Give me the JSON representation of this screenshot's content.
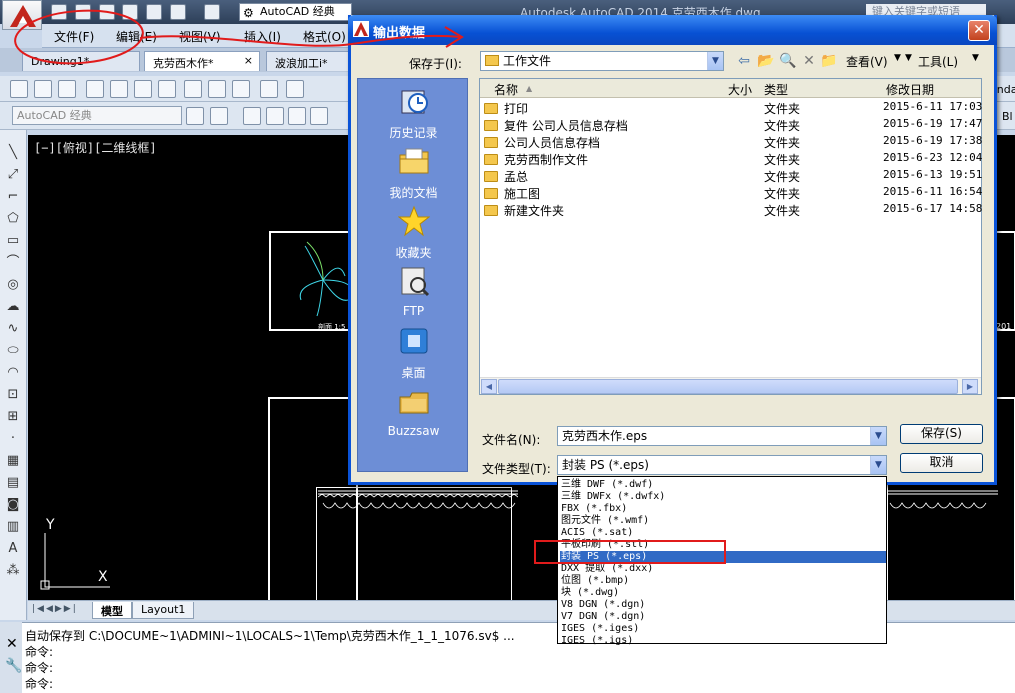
{
  "app": {
    "title": "Autodesk AutoCAD 2014    克劳西木作.dwg",
    "search_placeholder": "键入关键字或短语",
    "workspace": "AutoCAD 经典",
    "menu": [
      "文件(F)",
      "编辑(E)",
      "视图(V)",
      "插入(I)",
      "格式(O)"
    ],
    "doc_tabs": [
      "Drawing1*",
      "克劳西木作*",
      "波浪加工i*"
    ],
    "style_select": "AutoCAD 经典",
    "right_labels": [
      "andar",
      "Bl"
    ]
  },
  "canvas": {
    "view_label": "[−][俯视][二维线框]",
    "ucs_y": "Y",
    "ucs_x": "X",
    "frame_caption_left": "剖面 1:5",
    "frame_caption_right": "201"
  },
  "layout_tabs": [
    "模型",
    "Layout1"
  ],
  "command": {
    "autosave": "自动保存到 C:\\DOCUME~1\\ADMINI~1\\LOCALS~1\\Temp\\克劳西木作_1_1_1076.sv$ ...",
    "prompts": [
      "命令:",
      "命令:",
      "命令:"
    ]
  },
  "dialog": {
    "title": "输出数据",
    "save_in_label": "保存于(I):",
    "save_in_value": "工作文件",
    "view_label": "查看(V)",
    "tools_label": "工具(L)",
    "places": [
      {
        "label": "历史记录",
        "icon": "history-icon"
      },
      {
        "label": "我的文档",
        "icon": "my-documents-icon"
      },
      {
        "label": "收藏夹",
        "icon": "favorites-star-icon"
      },
      {
        "label": "FTP",
        "icon": "ftp-icon"
      },
      {
        "label": "桌面",
        "icon": "desktop-icon"
      },
      {
        "label": "Buzzsaw",
        "icon": "buzzsaw-icon"
      }
    ],
    "columns": [
      "名称",
      "大小",
      "类型",
      "修改日期"
    ],
    "files": [
      {
        "name": "打印",
        "type": "文件夹",
        "date": "2015-6-11 17:03"
      },
      {
        "name": "复件 公司人员信息存档",
        "type": "文件夹",
        "date": "2015-6-19 17:47"
      },
      {
        "name": "公司人员信息存档",
        "type": "文件夹",
        "date": "2015-6-19 17:38"
      },
      {
        "name": "克劳西制作文件",
        "type": "文件夹",
        "date": "2015-6-23 12:04"
      },
      {
        "name": "孟总",
        "type": "文件夹",
        "date": "2015-6-13 19:51"
      },
      {
        "name": "施工图",
        "type": "文件夹",
        "date": "2015-6-11 16:54"
      },
      {
        "name": "新建文件夹",
        "type": "文件夹",
        "date": "2015-6-17 14:58"
      }
    ],
    "filename_label": "文件名(N):",
    "filename_value": "克劳西木作.eps",
    "filetype_label": "文件类型(T):",
    "filetype_value": "封装 PS (*.eps)",
    "save_button": "保存(S)",
    "cancel_button": "取消",
    "filetype_options": [
      "三维 DWF (*.dwf)",
      "三维 DWFx (*.dwfx)",
      "FBX (*.fbx)",
      "图元文件 (*.wmf)",
      "ACIS (*.sat)",
      "平板印刷 (*.stl)",
      "封装 PS (*.eps)",
      "DXX 提取 (*.dxx)",
      "位图 (*.bmp)",
      "块 (*.dwg)",
      "V8 DGN (*.dgn)",
      "V7 DGN (*.dgn)",
      "IGES (*.iges)",
      "IGES (*.igs)"
    ],
    "selected_option_index": 6
  },
  "colors": {
    "dialog_title": "#0751d4",
    "selection": "#316ac5",
    "annotation": "#e11b1b",
    "places_bar": "#6d8ed6"
  }
}
